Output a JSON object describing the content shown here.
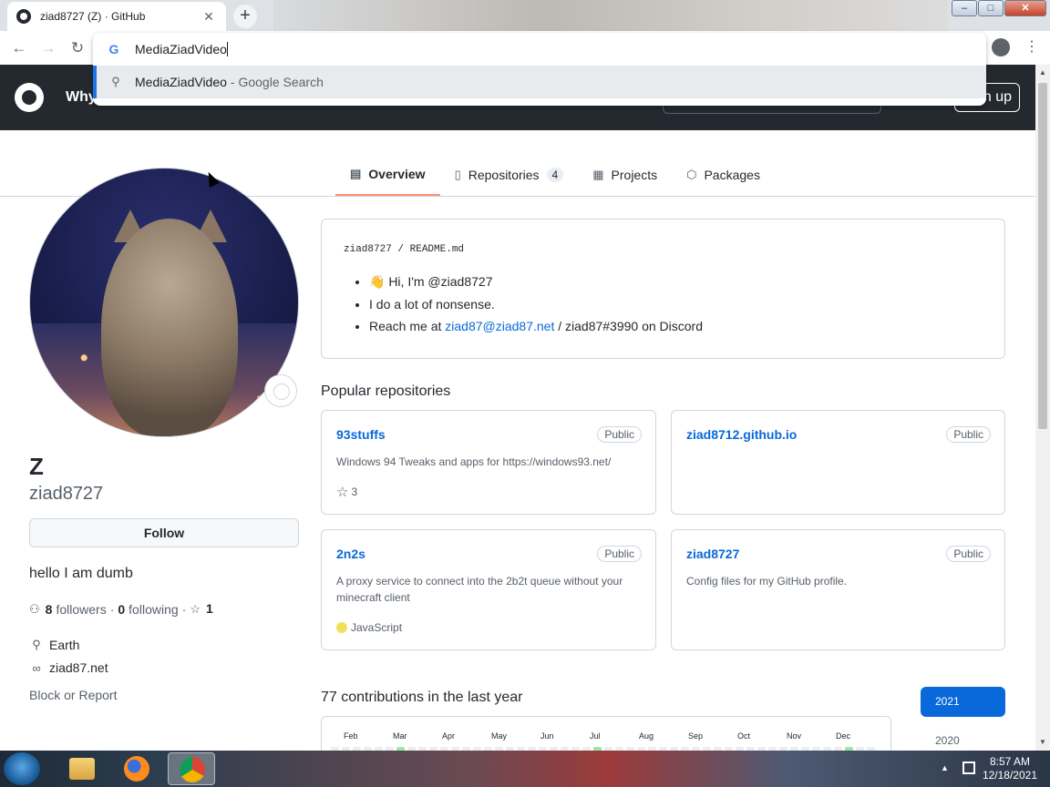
{
  "browser": {
    "tab_title": "ziad8727 (Z) · GitHub",
    "tab_close": "✕",
    "new_tab": "+",
    "omnibox_text": "MediaZiadVideo",
    "suggestion_query": "MediaZiadVideo",
    "suggestion_suffix": "- Google Search",
    "window": {
      "minimize": "–",
      "maximize": "□",
      "close": "✕"
    },
    "nav": {
      "back": "←",
      "forward": "→",
      "reload": "↻"
    },
    "menu": "⋮",
    "google_g": "G"
  },
  "github": {
    "header_why": "Why",
    "signup": "n up"
  },
  "tabs": [
    {
      "label": "Overview",
      "icon": "book-icon",
      "glyph": "▤"
    },
    {
      "label": "Repositories",
      "icon": "repo-icon",
      "glyph": "▯",
      "count": "4"
    },
    {
      "label": "Projects",
      "icon": "table-icon",
      "glyph": "▦"
    },
    {
      "label": "Packages",
      "icon": "package-icon",
      "glyph": "⬡"
    }
  ],
  "profile": {
    "name": "Z",
    "login": "ziad8727",
    "follow": "Follow",
    "bio": "hello I am dumb",
    "followers_count": "8",
    "followers_label": "followers",
    "following_count": "0",
    "following_label": "following",
    "stars_count": "1",
    "location": "Earth",
    "website": "ziad87.net",
    "block": "Block or Report"
  },
  "readme": {
    "path": "ziad8727 / README.md",
    "line1": "👋 Hi, I'm @ziad8727",
    "line2": "I do a lot of nonsense.",
    "line3_pre": "Reach me at",
    "line3_link": "ziad87@ziad87.net",
    "line3_post": "/ ziad87#3990 on Discord"
  },
  "popular_title": "Popular repositories",
  "repos": [
    {
      "name": "93stuffs",
      "badge": "Public",
      "desc": "Windows 94 Tweaks and apps for https://windows93.net/",
      "stars": "3"
    },
    {
      "name": "ziad8712.github.io",
      "badge": "Public",
      "desc": ""
    },
    {
      "name": "2n2s",
      "badge": "Public",
      "desc": "A proxy service to connect into the 2b2t queue without your minecraft client",
      "language": "JavaScript",
      "language_color": "#f1e05a"
    },
    {
      "name": "ziad8727",
      "badge": "Public",
      "desc": "Config files for my GitHub profile."
    }
  ],
  "contributions": {
    "title": "77 contributions in the last year",
    "months": [
      "Feb",
      "Mar",
      "Apr",
      "May",
      "Jun",
      "Jul",
      "Aug",
      "Sep",
      "Oct",
      "Nov",
      "Dec"
    ],
    "year_active": "2021",
    "year_other": "2020"
  },
  "taskbar": {
    "time": "8:57 AM",
    "date": "12/18/2021",
    "tray_arrow": "▲"
  },
  "colors": {
    "accent": "#0969da",
    "header_bg": "#24292f",
    "tab_underline": "#fd8c73"
  }
}
